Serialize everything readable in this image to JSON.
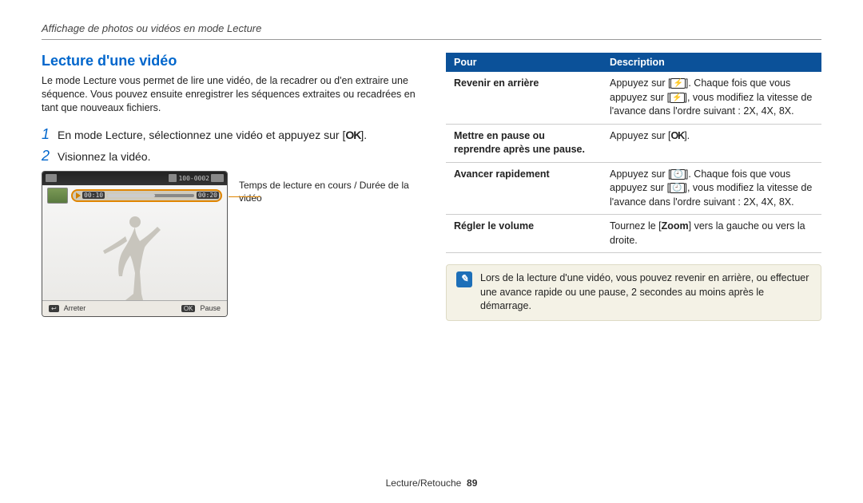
{
  "breadcrumb": "Affichage de photos ou vidéos en mode Lecture",
  "left": {
    "title": "Lecture d'une vidéo",
    "intro": "Le mode Lecture vous permet de lire une vidéo, de la recadrer ou d'en extraire une séquence. Vous pouvez ensuite enregistrer les séquences extraites ou recadrées en tant que nouveaux fichiers.",
    "step1_num": "1",
    "step1_pre": "En mode Lecture, sélectionnez une vidéo et appuyez sur [",
    "step1_ok": "OK",
    "step1_post": "].",
    "step2_num": "2",
    "step2": "Visionnez la vidéo.",
    "shot": {
      "counter": "100-0002",
      "t_cur": "00:10",
      "t_tot": "00:20",
      "btn_back_label": "Arreter",
      "btn_ok": "OK",
      "btn_ok_label": "Pause"
    },
    "caption": "Temps de lecture en cours / Durée de la vidéo"
  },
  "table": {
    "h1": "Pour",
    "h2": "Description",
    "rows": [
      {
        "action": "Revenir en arrière",
        "desc_pre": "Appuyez sur [",
        "icon": "flash",
        "desc_mid": "]. Chaque fois que vous appuyez sur [",
        "desc_post": "], vous modifiez la vitesse de l'avance dans l'ordre suivant : 2X, 4X, 8X."
      },
      {
        "action": "Mettre en pause ou reprendre après une pause.",
        "desc_pre": "Appuyez sur [",
        "icon": "ok",
        "desc_post": "]."
      },
      {
        "action": "Avancer rapidement",
        "desc_pre": "Appuyez sur [",
        "icon": "timer",
        "desc_mid": "]. Chaque fois que vous appuyez sur [",
        "desc_post": "], vous modifiez la vitesse de l'avance dans l'ordre suivant : 2X, 4X, 8X."
      },
      {
        "action": "Régler le volume",
        "desc_pre": "Tournez le [",
        "bold": "Zoom",
        "desc_post": "] vers la gauche ou vers la droite."
      }
    ]
  },
  "note": "Lors de la lecture d'une vidéo, vous pouvez revenir en arrière, ou effectuer une avance rapide ou une pause, 2 secondes au moins après le démarrage.",
  "footer_section": "Lecture/Retouche",
  "footer_page": "89"
}
